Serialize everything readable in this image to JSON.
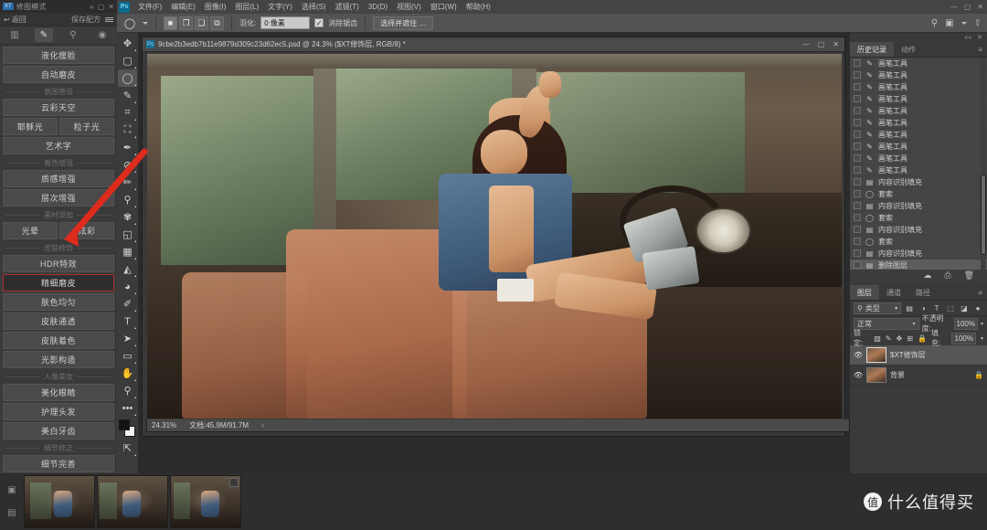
{
  "plugin": {
    "badge": "XT",
    "title": "修图模式",
    "collapse_icon": "«",
    "min_icon": "▢",
    "close_icon": "✕",
    "back_label": "返回",
    "save_recipe_label": "保存配方",
    "menu_icon": "hamburger-icon",
    "toolbar_icons": [
      "grid-icon",
      "brush-icon",
      "stamp-icon",
      "eye-icon"
    ],
    "groups": [
      {
        "label": "",
        "rows": [
          [
            "液化瘦脸"
          ],
          [
            "自动磨皮"
          ]
        ]
      },
      {
        "label": "氛围营造",
        "rows": [
          [
            "云彩天空"
          ],
          [
            "耶稣光",
            "粒子光"
          ],
          [
            "艺术字"
          ]
        ]
      },
      {
        "label": "着色增强",
        "rows": [
          [
            "质感增强"
          ],
          [
            "层次增强"
          ]
        ]
      },
      {
        "label": "素材添加",
        "rows": [
          [
            "光晕",
            "炫彩"
          ]
        ]
      },
      {
        "label": "皮肤修饰",
        "rows": [
          [
            "HDR特效"
          ],
          [
            "精细磨皮"
          ],
          [
            "肤色均匀"
          ],
          [
            "皮肤通透"
          ],
          [
            "皮肤着色"
          ],
          [
            "光影构造"
          ]
        ]
      },
      {
        "label": "人像美妆",
        "rows": [
          [
            "美化眼睛"
          ],
          [
            "护理头发"
          ],
          [
            "美白牙齿"
          ]
        ]
      },
      {
        "label": "细节修正",
        "rows": [
          [
            "细节完善"
          ]
        ]
      }
    ],
    "selected_item": "精细磨皮"
  },
  "tools": {
    "items": [
      {
        "name": "move-tool",
        "glyph": "✥"
      },
      {
        "name": "marquee-tool",
        "glyph": "▢"
      },
      {
        "name": "lasso-tool",
        "glyph": "◯"
      },
      {
        "name": "quick-select-tool",
        "glyph": "✎"
      },
      {
        "name": "crop-tool",
        "glyph": "⌗"
      },
      {
        "name": "frame-tool",
        "glyph": "⛶"
      },
      {
        "name": "eyedropper-tool",
        "glyph": "✒"
      },
      {
        "name": "healing-brush-tool",
        "glyph": "⊘"
      },
      {
        "name": "brush-tool",
        "glyph": "✏"
      },
      {
        "name": "clone-stamp-tool",
        "glyph": "⚲"
      },
      {
        "name": "history-brush-tool",
        "glyph": "✾"
      },
      {
        "name": "eraser-tool",
        "glyph": "◱"
      },
      {
        "name": "gradient-tool",
        "glyph": "▦"
      },
      {
        "name": "blur-tool",
        "glyph": "◭"
      },
      {
        "name": "dodge-tool",
        "glyph": "◕"
      },
      {
        "name": "pen-tool",
        "glyph": "✐"
      },
      {
        "name": "type-tool",
        "glyph": "T"
      },
      {
        "name": "path-select-tool",
        "glyph": "➤"
      },
      {
        "name": "shape-tool",
        "glyph": "▭"
      },
      {
        "name": "hand-tool",
        "glyph": "✋"
      },
      {
        "name": "zoom-tool",
        "glyph": "⚲"
      },
      {
        "name": "edit-toolbar",
        "glyph": "•••"
      },
      {
        "name": "quickmask-tool",
        "glyph": "◧"
      },
      {
        "name": "screenmode-tool",
        "glyph": "⇱"
      }
    ],
    "active": "lasso-tool"
  },
  "menubar": {
    "logo": "Ps",
    "items": [
      "文件(F)",
      "编辑(E)",
      "图像(I)",
      "图层(L)",
      "文字(Y)",
      "选择(S)",
      "滤镜(T)",
      "3D(D)",
      "视图(V)",
      "窗口(W)",
      "帮助(H)"
    ],
    "right_icons": [
      "minimize-icon",
      "restore-icon",
      "close-icon"
    ]
  },
  "options": {
    "tool_icon": "lasso-icon",
    "dropdown_icon": "chevron-down-icon",
    "selection_modes": [
      "new-selection",
      "add-to-selection",
      "subtract-from-selection",
      "intersect-selection"
    ],
    "feather_label": "羽化:",
    "feather_value": "0 像素",
    "antialias_label": "消除锯齿",
    "antialias_checked": true,
    "select_and_mask_label": "选择并遮住 …",
    "right_icons": [
      "search-icon",
      "workspace-icon",
      "share-icon"
    ]
  },
  "document": {
    "tab_icon": "psd-file-icon",
    "tab_title": "9cbe2b3edb7b11e9879d309c23d62ec5.psd @ 24.3% ($XT修饰层, RGB/8) *",
    "window_buttons": [
      "minimize-icon",
      "maximize-icon",
      "close-icon"
    ],
    "status_zoom": "24.31%",
    "status_doc": "文档:45.9M/91.7M",
    "status_arrow": "›"
  },
  "history": {
    "tabs": [
      {
        "label": "历史记录",
        "active": true
      },
      {
        "label": "动作",
        "active": false
      }
    ],
    "menu_icon": "panel-menu-icon",
    "panel_ctrls": [
      "collapse-icon",
      "close-icon"
    ],
    "entries": [
      {
        "icon": "brush-icon",
        "label": "画笔工具",
        "selected": false
      },
      {
        "icon": "brush-icon",
        "label": "画笔工具",
        "selected": false
      },
      {
        "icon": "brush-icon",
        "label": "画笔工具",
        "selected": false
      },
      {
        "icon": "brush-icon",
        "label": "画笔工具",
        "selected": false
      },
      {
        "icon": "brush-icon",
        "label": "画笔工具",
        "selected": false
      },
      {
        "icon": "brush-icon",
        "label": "画笔工具",
        "selected": false
      },
      {
        "icon": "brush-icon",
        "label": "画笔工具",
        "selected": false
      },
      {
        "icon": "brush-icon",
        "label": "画笔工具",
        "selected": false
      },
      {
        "icon": "brush-icon",
        "label": "画笔工具",
        "selected": false
      },
      {
        "icon": "brush-icon",
        "label": "画笔工具",
        "selected": false
      },
      {
        "icon": "fill-icon",
        "label": "内容识别填充",
        "selected": false
      },
      {
        "icon": "lasso-icon",
        "label": "套索",
        "selected": false
      },
      {
        "icon": "fill-icon",
        "label": "内容识别填充",
        "selected": false
      },
      {
        "icon": "lasso-icon",
        "label": "套索",
        "selected": false
      },
      {
        "icon": "fill-icon",
        "label": "内容识别填充",
        "selected": false
      },
      {
        "icon": "lasso-icon",
        "label": "套索",
        "selected": false
      },
      {
        "icon": "fill-icon",
        "label": "内容识别填充",
        "selected": false
      },
      {
        "icon": "delete-layer-icon",
        "label": "删除图层",
        "selected": true
      }
    ],
    "footer_icons": [
      "snapshot-icon",
      "new-document-icon",
      "trash-icon"
    ]
  },
  "layers": {
    "tabs": [
      {
        "label": "图层",
        "active": true
      },
      {
        "label": "通道",
        "active": false
      },
      {
        "label": "路径",
        "active": false
      }
    ],
    "menu_icon": "panel-menu-icon",
    "filter_icon": "search-icon",
    "filter_value": "类型",
    "filter_chevron": "chevron-down-icon",
    "filter_type_icons": [
      "pixel-icon",
      "adjustment-icon",
      "type-icon",
      "shape-icon",
      "smart-object-icon",
      "filter-toggle-icon"
    ],
    "blend_mode": "正常",
    "opacity_label": "不透明度:",
    "opacity_value": "100%",
    "lock_label": "锁定:",
    "lock_icons": [
      "lock-transparent-icon",
      "lock-image-icon",
      "lock-position-icon",
      "lock-artboard-icon",
      "lock-all-icon"
    ],
    "fill_label": "填充:",
    "fill_value": "100%",
    "items": [
      {
        "name": "$XT修饰层",
        "visible": true,
        "locked": false,
        "selected": true
      },
      {
        "name": "背景",
        "visible": true,
        "locked": true,
        "selected": false
      }
    ]
  },
  "filmstrip": {
    "side_icons": [
      "image-icon",
      "folder-icon"
    ],
    "thumbnails": [
      {
        "name": "thumbnail-1",
        "badge": false
      },
      {
        "name": "thumbnail-2",
        "badge": false
      },
      {
        "name": "thumbnail-3",
        "badge": true
      }
    ]
  },
  "watermark": {
    "logo_char": "值",
    "text": "什么值得买"
  },
  "colors": {
    "accent_red": "#c0392b",
    "panel_bg": "#3a3a3a",
    "toolbar_bg": "#535353",
    "canvas_bg": "#2b2b2b"
  }
}
